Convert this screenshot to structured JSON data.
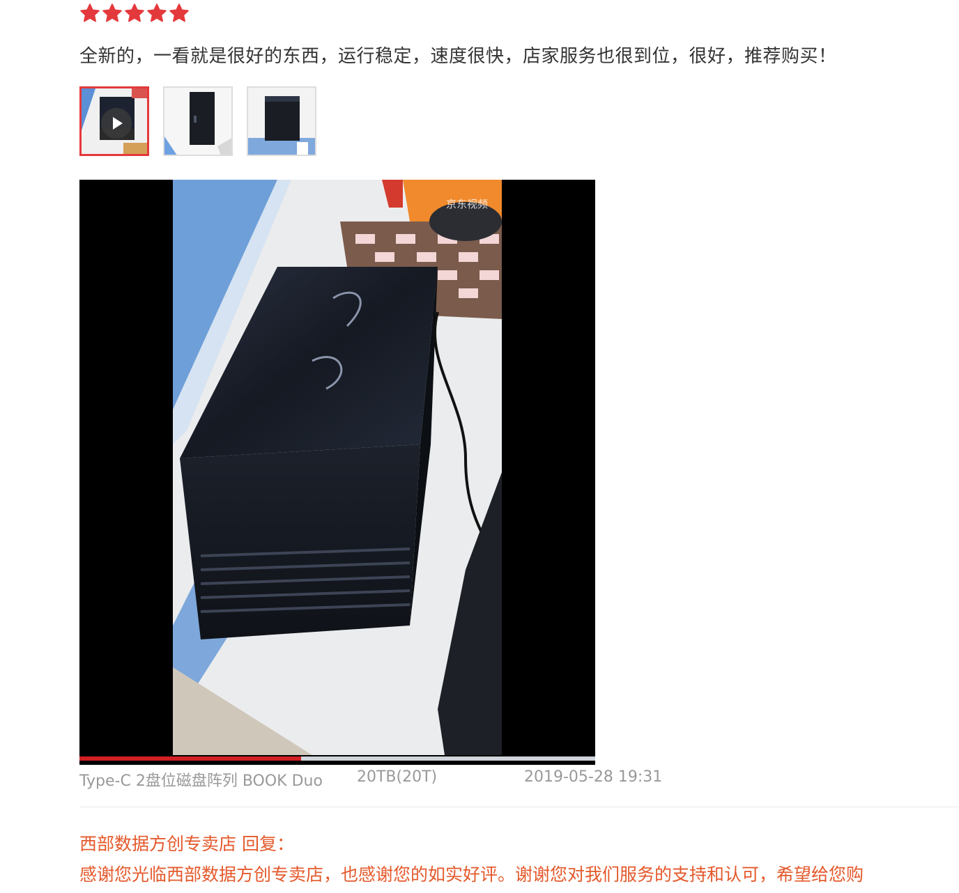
{
  "review": {
    "rating": 5,
    "rating_max": 5,
    "star_color": "#e4393c",
    "text": "全新的，一看就是很好的东西，运行稳定，速度很快，店家服务也很到位，很好，推荐购买！",
    "thumbnails": [
      {
        "type": "video",
        "active": true
      },
      {
        "type": "image",
        "active": false
      },
      {
        "type": "image",
        "active": false
      }
    ],
    "video": {
      "watermark": "京东视频",
      "progress": 0.43
    },
    "product_spec": "Type-C 2盘位磁盘阵列 BOOK Duo",
    "capacity": "20TB(20T)",
    "datetime": "2019-05-28 19:31"
  },
  "reply": {
    "title": "西部数据方创专卖店 回复：",
    "text": "感谢您光临西部数据方创专卖店，也感谢您的如实好评。谢谢您对我们服务的支持和认可，希望给您购"
  },
  "colors": {
    "accent": "#e4393c",
    "reply": "#e4592b",
    "meta": "#999999"
  }
}
